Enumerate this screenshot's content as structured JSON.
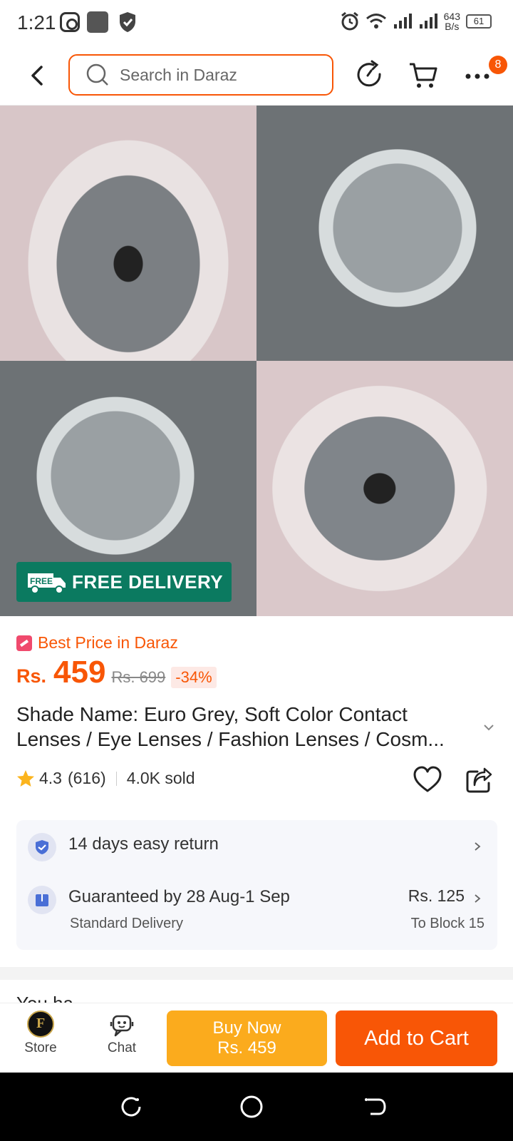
{
  "status_bar": {
    "time": "1:21",
    "net_speed_value": "643",
    "net_speed_unit": "B/s",
    "battery": "61"
  },
  "header": {
    "search_placeholder": "Search in Daraz",
    "cart_badge": "8"
  },
  "product": {
    "badge_label": "FREE DELIVERY",
    "truck_label": "FREE",
    "best_price_label": "Best Price in Daraz",
    "currency": "Rs.",
    "price": "459",
    "original_price": "Rs. 699",
    "discount": "-34%",
    "title_line1": "Shade Name: Euro Grey, Soft Color Contact",
    "title_line2": "Lenses / Eye Lenses / Fashion Lenses / Cosm...",
    "rating": "4.3",
    "review_count": "(616)",
    "sold": "4.0K sold"
  },
  "services": {
    "return_label": "14 days easy return",
    "delivery_label": "Guaranteed by 28 Aug-1 Sep",
    "delivery_type": "Standard Delivery",
    "delivery_fee": "Rs. 125",
    "delivery_destination": "To Block 15"
  },
  "next_section_peek": "You ha",
  "bottom_bar": {
    "store_label": "Store",
    "chat_label": "Chat",
    "buy_now_label": "Buy Now",
    "buy_now_price": "Rs. 459",
    "add_to_cart_label": "Add to Cart"
  },
  "colors": {
    "accent": "#f85606",
    "buy_now": "#fbab1d",
    "free_delivery_badge": "#0b7a60"
  }
}
